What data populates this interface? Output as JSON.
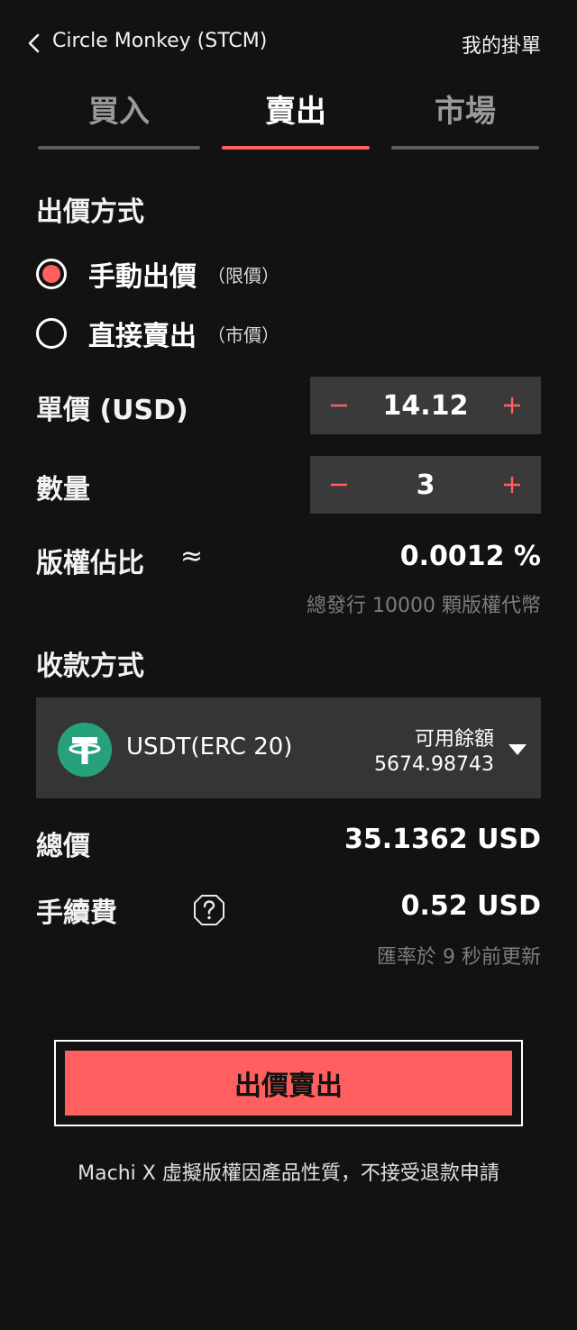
{
  "header": {
    "title": "Circle Monkey (STCM)",
    "my_orders": "我的掛單"
  },
  "tabs": [
    {
      "label": "買入",
      "active": false
    },
    {
      "label": "賣出",
      "active": true
    },
    {
      "label": "市場",
      "active": false
    }
  ],
  "pricing_method": {
    "title": "出價方式",
    "options": [
      {
        "label": "手動出價",
        "sub": "（限價）",
        "selected": true
      },
      {
        "label": "直接賣出",
        "sub": "（市價）",
        "selected": false
      }
    ]
  },
  "unit_price": {
    "label": "單價 (USD)",
    "value": "14.12"
  },
  "quantity": {
    "label": "數量",
    "value": "3"
  },
  "share": {
    "label": "版權佔比",
    "approx": "≈",
    "value": "0.0012 %",
    "note": "總發行 10000 顆版權代幣"
  },
  "payment": {
    "title": "收款方式",
    "coin": "USDT(ERC 20)",
    "coin_icon": "tether-icon",
    "balance_label": "可用餘額",
    "balance_value": "5674.98743"
  },
  "total": {
    "label": "總價",
    "value": "35.1362 USD"
  },
  "fee": {
    "label": "手續費",
    "value": "0.52 USD",
    "note": "匯率於 9 秒前更新"
  },
  "submit_label": "出價賣出",
  "disclaimer": "Machi X 虛擬版權因產品性質，不接受退款申請",
  "colors": {
    "accent": "#ff5f5f",
    "background": "#121212",
    "panel": "#3a3a3a",
    "tether": "#26a17b"
  }
}
